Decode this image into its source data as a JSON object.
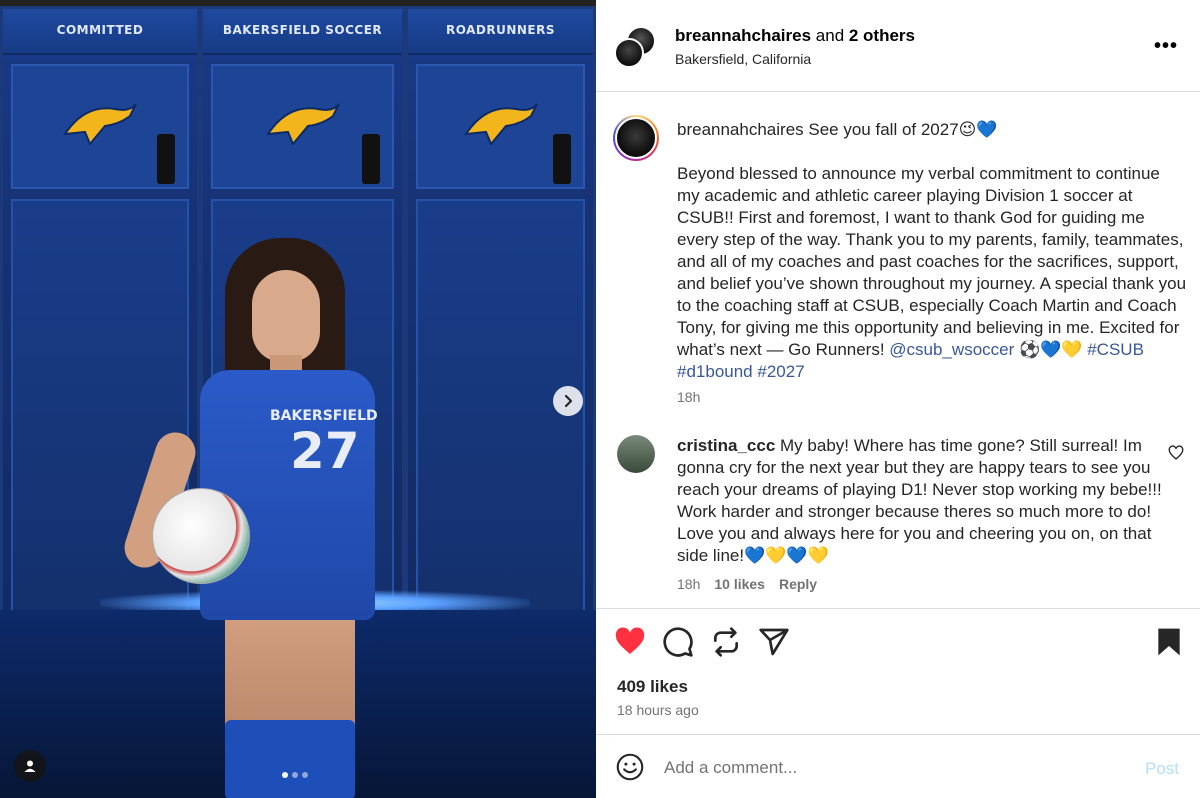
{
  "photo": {
    "lockers": [
      "COMMITTED",
      "BAKERSFIELD SOCCER",
      "ROADRUNNERS"
    ],
    "jersey_name": "BAKERSFIELD",
    "jersey_number": "27",
    "next_icon": "chevron-right-icon",
    "carousel_total": 3,
    "carousel_active": 1
  },
  "header": {
    "username": "breannahchaires",
    "and_text": " and ",
    "others": "2 others",
    "location": "Bakersfield, California",
    "more_icon": "•••"
  },
  "caption": {
    "username": "breannahchaires",
    "first_line": " See you fall of 2027😉💙",
    "body": "Beyond blessed to announce my verbal commitment to continue my academic and athletic career playing Division 1 soccer at CSUB!! First and foremost, I want to thank God for guiding me every step of the way. Thank you to my parents, family, teammates, and all of my coaches and past coaches for the sacrifices, support, and belief you’ve shown throughout my journey. A special thank you to the coaching staff at CSUB, especially Coach Martin and Coach Tony, for giving me this opportunity and believing in me. Excited for what’s next — Go Runners! ",
    "mention": "@csub_wsoccer",
    "emojis": " ⚽💙💛 ",
    "hashtags": [
      "#CSUB",
      "#d1bound",
      "#2027"
    ],
    "time": "18h"
  },
  "comment": {
    "username": "cristina_ccc",
    "text": " My baby! Where has time gone? Still surreal! Im gonna cry for the next year but they are happy tears to see you reach your dreams of playing D1! Never stop working my bebe!!! Work harder and stronger because theres so much more to do! Love you and always here for you and cheering you on, on that side line!💙💛💙💛",
    "time": "18h",
    "likes": "10 likes",
    "reply": "Reply"
  },
  "actions": {
    "likes": "409 likes",
    "ago": "18 hours ago",
    "like_color": "#ff3040"
  },
  "add_comment": {
    "placeholder": "Add a comment...",
    "post": "Post"
  },
  "colors": {
    "link": "#385898",
    "muted": "#737373",
    "post_disabled": "#b2dffc"
  }
}
